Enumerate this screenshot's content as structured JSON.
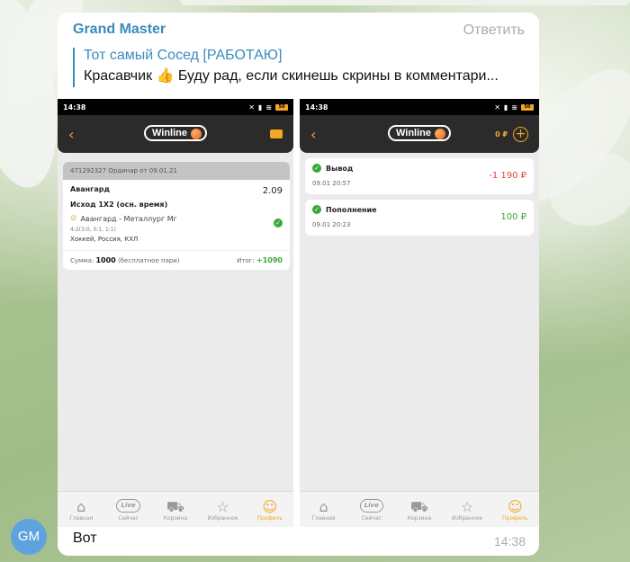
{
  "chat": {
    "sender": "Grand Master",
    "reply_action": "Ответить",
    "quote_author": "Тот самый Сосед [РАБОТАЮ]",
    "quote_text": "Красавчик 👍  Буду рад, если скинешь скрины в комментари...",
    "message_text": "Вот",
    "message_time": "14:38",
    "avatar_initials": "GM"
  },
  "phone": {
    "time": "14:38",
    "battery": "50",
    "brand": "Winline"
  },
  "bet": {
    "header": "471292327  Ординар  от 09.01.21",
    "team": "Авангард",
    "odds": "2.09",
    "outcome": "Исход 1Х2 (осн. время)",
    "match": "Авангард - Металлург Мг",
    "score": "4:2(3:0, 0:1, 1:1)",
    "league": "Хоккей, Россия, КХЛ",
    "sum_label": "Сумма:",
    "sum_value": "1000",
    "sum_note": "(бесплатное пари)",
    "result_label": "Итог:",
    "result_value": "+1090"
  },
  "wallet": {
    "balance": "0 ₽",
    "transactions": [
      {
        "title": "Вывод",
        "date": "09.01 20:57",
        "amount": "-1 190 ₽"
      },
      {
        "title": "Пополнение",
        "date": "09.01 20:23",
        "amount": "100 ₽"
      }
    ]
  },
  "tabs": [
    "Главная",
    "Сейчас",
    "Корзина",
    "Избранное",
    "Профиль"
  ],
  "live_label": "Live"
}
